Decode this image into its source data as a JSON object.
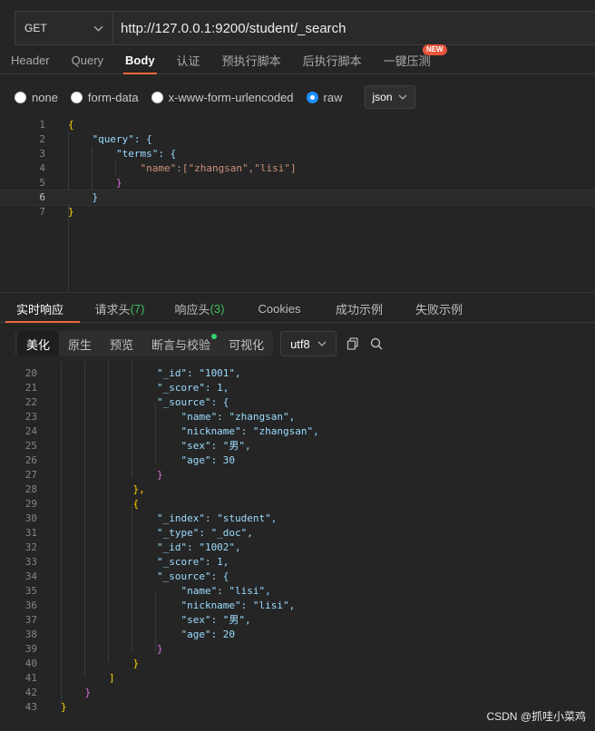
{
  "request": {
    "method": "GET",
    "url": "http://127.0.0.1:9200/student/_search"
  },
  "request_tabs": [
    {
      "label": "Header"
    },
    {
      "label": "Query"
    },
    {
      "label": "Body"
    },
    {
      "label": "认证"
    },
    {
      "label": "预执行脚本"
    },
    {
      "label": "后执行脚本"
    },
    {
      "label": "一键压测"
    }
  ],
  "new_badge": "NEW",
  "body_types": [
    "none",
    "form-data",
    "x-www-form-urlencoded",
    "raw"
  ],
  "body_format": "json",
  "request_body": [
    {
      "num": "1",
      "text": "{"
    },
    {
      "num": "2",
      "text": "    \"query\": {"
    },
    {
      "num": "3",
      "text": "        \"terms\": {"
    },
    {
      "num": "4",
      "text": "            \"name\":[\"zhangsan\",\"lisi\"]"
    },
    {
      "num": "5",
      "text": "        }"
    },
    {
      "num": "6",
      "text": "    }"
    },
    {
      "num": "7",
      "text": "}"
    }
  ],
  "response_tabs": {
    "realtime": "实时响应",
    "req_headers": "请求头",
    "req_headers_count": "(7)",
    "resp_headers": "响应头",
    "resp_headers_count": "(3)",
    "cookies": "Cookies",
    "success_example": "成功示例",
    "fail_example": "失败示例"
  },
  "view_modes": [
    "美化",
    "原生",
    "预览",
    "断言与校验",
    "可视化"
  ],
  "encoding": "utf8",
  "response_body": [
    {
      "num": "20",
      "text": "                \"_id\": \"1001\","
    },
    {
      "num": "21",
      "text": "                \"_score\": 1,"
    },
    {
      "num": "22",
      "text": "                \"_source\": {"
    },
    {
      "num": "23",
      "text": "                    \"name\": \"zhangsan\","
    },
    {
      "num": "24",
      "text": "                    \"nickname\": \"zhangsan\","
    },
    {
      "num": "25",
      "text": "                    \"sex\": \"男\","
    },
    {
      "num": "26",
      "text": "                    \"age\": 30"
    },
    {
      "num": "27",
      "text": "                }"
    },
    {
      "num": "28",
      "text": "            },"
    },
    {
      "num": "29",
      "text": "            {"
    },
    {
      "num": "30",
      "text": "                \"_index\": \"student\","
    },
    {
      "num": "31",
      "text": "                \"_type\": \"_doc\","
    },
    {
      "num": "32",
      "text": "                \"_id\": \"1002\","
    },
    {
      "num": "33",
      "text": "                \"_score\": 1,"
    },
    {
      "num": "34",
      "text": "                \"_source\": {"
    },
    {
      "num": "35",
      "text": "                    \"name\": \"lisi\","
    },
    {
      "num": "36",
      "text": "                    \"nickname\": \"lisi\","
    },
    {
      "num": "37",
      "text": "                    \"sex\": \"男\","
    },
    {
      "num": "38",
      "text": "                    \"age\": 20"
    },
    {
      "num": "39",
      "text": "                }"
    },
    {
      "num": "40",
      "text": "            }"
    },
    {
      "num": "41",
      "text": "        ]"
    },
    {
      "num": "42",
      "text": "    }"
    },
    {
      "num": "43",
      "text": "}"
    }
  ],
  "watermark": "CSDN @抓哇小菜鸡"
}
